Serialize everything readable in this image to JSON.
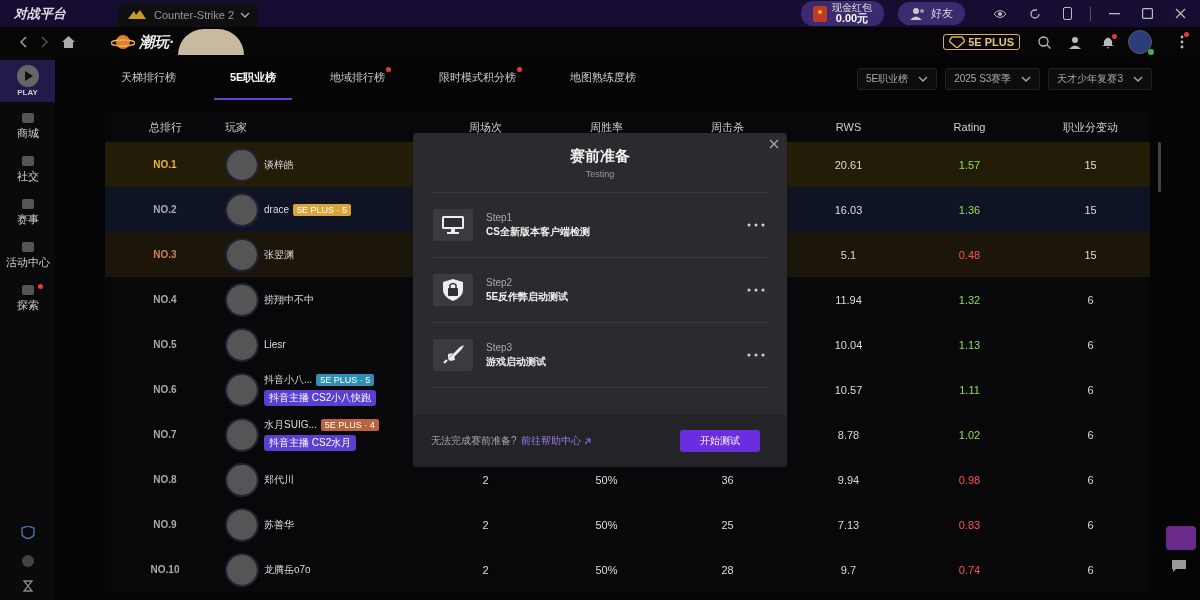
{
  "app": {
    "logo_text": "对战平台",
    "game_tab": "Counter-Strike 2",
    "red_packet": {
      "label": "现金红包",
      "amount": "0.00元"
    },
    "friends_button": "好友"
  },
  "nav": {
    "brand": "潮玩·",
    "plus_badge": "5E PLUS",
    "notification_dot": true,
    "menu_dot": true
  },
  "sidebar": {
    "play": "PLAY",
    "items": [
      {
        "label": "商城",
        "dot": false
      },
      {
        "label": "社交",
        "dot": false
      },
      {
        "label": "赛事",
        "dot": false
      },
      {
        "label": "活动中心",
        "dot": false
      },
      {
        "label": "探索",
        "dot": true
      }
    ]
  },
  "tabs": [
    {
      "label": "天梯排行榜",
      "selected": false,
      "dot": false
    },
    {
      "label": "5E职业榜",
      "selected": true,
      "dot": false
    },
    {
      "label": "地域排行榜",
      "selected": false,
      "dot": true
    },
    {
      "label": "限时模式积分榜",
      "selected": false,
      "dot": true
    },
    {
      "label": "地图熟练度榜",
      "selected": false,
      "dot": false
    }
  ],
  "filters": [
    "5E职业榜",
    "2025 S3赛季",
    "天才少年复赛3"
  ],
  "table": {
    "columns": [
      "总排行",
      "玩家",
      "周场次",
      "周胜率",
      "周击杀",
      "RWS",
      "Rating",
      "职业分变动"
    ],
    "rows": [
      {
        "rank": "NO.1",
        "kind": "gold",
        "player": "谈梓皓",
        "rws": "20.61",
        "rating": "1.57",
        "rating_good": true,
        "change": "15"
      },
      {
        "rank": "NO.2",
        "kind": "silver",
        "player": "drace",
        "plus_badge": {
          "text": "5E PLUS · 5",
          "color": "#d9a53a"
        },
        "rws": "16.03",
        "rating": "1.36",
        "rating_good": true,
        "change": "15"
      },
      {
        "rank": "NO.3",
        "kind": "bronze",
        "player": "张翌渊",
        "rws": "5.1",
        "rating": "0.48",
        "rating_good": false,
        "change": "15"
      },
      {
        "rank": "NO.4",
        "kind": "plain",
        "player": "捞翔中不中",
        "rws": "11.94",
        "rating": "1.32",
        "rating_good": true,
        "change": "6"
      },
      {
        "rank": "NO.5",
        "kind": "plain",
        "player": "Liesr",
        "rws": "10.04",
        "rating": "1.13",
        "rating_good": true,
        "change": "6"
      },
      {
        "rank": "NO.6",
        "kind": "plain",
        "player": "抖音小八...",
        "plus_badge": {
          "text": "5E PLUS · 5",
          "color": "#2f8fb5"
        },
        "streamer_tag": "抖音主播 CS2小八快跑",
        "rws": "10.57",
        "rating": "1.11",
        "rating_good": true,
        "change": "6"
      },
      {
        "rank": "NO.7",
        "kind": "plain",
        "player": "水月SUIG...",
        "plus_badge": {
          "text": "5E PLUS · 4",
          "color": "#b8643e"
        },
        "streamer_tag": "抖音主播 CS2水月",
        "rws": "8.78",
        "rating": "1.02",
        "rating_good": true,
        "change": "6"
      },
      {
        "rank": "NO.8",
        "kind": "plain",
        "player": "郑代川",
        "games": "2",
        "win_rate": "50%",
        "kills": "36",
        "rws": "9.94",
        "rating": "0.98",
        "rating_good": false,
        "change": "6"
      },
      {
        "rank": "NO.9",
        "kind": "plain",
        "player": "苏善华",
        "games": "2",
        "win_rate": "50%",
        "kills": "25",
        "rws": "7.13",
        "rating": "0.83",
        "rating_good": false,
        "change": "6"
      },
      {
        "rank": "NO.10",
        "kind": "plain",
        "player": "龙腾岳o7o",
        "games": "2",
        "win_rate": "50%",
        "kills": "28",
        "rws": "9.7",
        "rating": "0.74",
        "rating_good": false,
        "change": "6"
      }
    ]
  },
  "dialog": {
    "title": "赛前准备",
    "subtitle": "Testing",
    "steps": [
      {
        "kind": "monitor",
        "label": "Step1",
        "title": "CS全新版本客户端检测"
      },
      {
        "kind": "shield",
        "label": "Step2",
        "title": "5E反作弊启动测试"
      },
      {
        "kind": "rocket",
        "label": "Step3",
        "title": "游戏启动测试"
      }
    ],
    "question": "无法完成赛前准备?",
    "help_link": "前往帮助中心",
    "start_button": "开始测试"
  }
}
